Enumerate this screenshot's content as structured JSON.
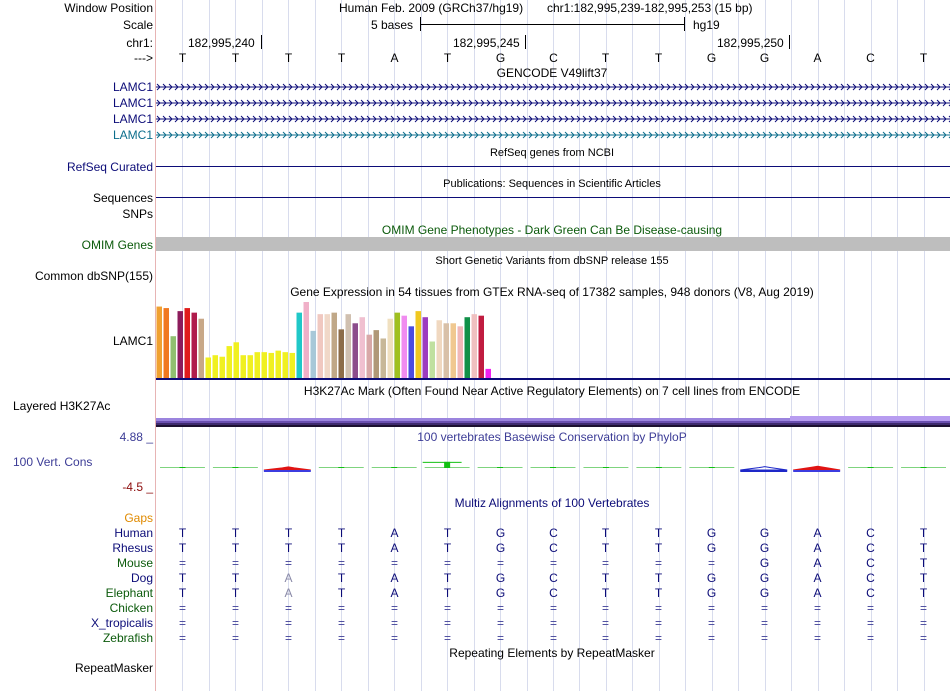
{
  "colors": {
    "gencode_blue": "#0c0c78",
    "gencode_teal": "#0c6e8c",
    "omim_green": "#0b5a0b",
    "conservation_blue": "#3c3c96",
    "conservation_low": "#8c0c0c",
    "gaps_orange": "#e08a00",
    "multiz_blue": "#0c0c78",
    "multiz_green": "#0b5a0b",
    "omim_bar_gray": "#bebebe",
    "h3k27ac_purple": "#6a4fb0"
  },
  "labels": {
    "window_position": "Window Position",
    "scale": "Scale",
    "chr": "chr1:",
    "direction": "--->",
    "gencode_tracks": [
      "LAMC1",
      "LAMC1",
      "LAMC1",
      "LAMC1"
    ],
    "refseq": "RefSeq Curated",
    "sequences": "Sequences",
    "snps": "SNPs",
    "omim": "OMIM Genes",
    "dbsnp": "Common dbSNP(155)",
    "gtex_gene": "LAMC1",
    "h3k27ac": "Layered H3K27Ac",
    "cons_top": "4.88 _",
    "cons_name": "100 Vert. Cons",
    "cons_bottom": "-4.5 _",
    "gaps": "Gaps",
    "species": [
      "Human",
      "Rhesus",
      "Mouse",
      "Dog",
      "Elephant",
      "Chicken",
      "X_tropicalis",
      "Zebrafish"
    ],
    "repeatmasker": "RepeatMasker"
  },
  "header": {
    "assembly": "Human Feb. 2009 (GRCh37/hg19)",
    "position": "chr1:182,995,239-182,995,253 (15 bp)",
    "scale_text": "5 bases",
    "scale_db": "hg19",
    "coords": [
      "182,995,240",
      "182,995,245",
      "182,995,250"
    ]
  },
  "bases": [
    "T",
    "T",
    "T",
    "T",
    "A",
    "T",
    "G",
    "C",
    "T",
    "T",
    "G",
    "G",
    "A",
    "C",
    "T"
  ],
  "track_titles": {
    "gencode": "GENCODE V49lift37",
    "refseq": "RefSeq genes from NCBI",
    "publications": "Publications: Sequences in Scientific Articles",
    "omim": "OMIM Gene Phenotypes - Dark Green Can Be Disease-causing",
    "dbsnp": "Short Genetic Variants from dbSNP release 155",
    "gtex": "Gene Expression in 54 tissues from GTEx RNA-seq of 17382 samples, 948 donors (V8, Aug 2019)",
    "h3k27ac": "H3K27Ac Mark (Often Found Near Active Regulatory Elements) on 7 cell lines from ENCODE",
    "phylop": "100 vertebrates Basewise Conservation by PhyloP",
    "multiz": "Multiz Alignments of 100 Vertebrates",
    "repeatmasker": "Repeating Elements by RepeatMasker"
  },
  "gtex_bars": {
    "colors": [
      "#f0a030",
      "#f07820",
      "#90c070",
      "#8c1c5c",
      "#e01c1c",
      "#b01c4c",
      "#c8a888",
      "#f0f020",
      "#f0f020",
      "#f0f020",
      "#f0f020",
      "#f0f020",
      "#f0f020",
      "#f0f020",
      "#f0f020",
      "#f0f020",
      "#f0f020",
      "#f0f020",
      "#f0f020",
      "#f0f020",
      "#20c8c8",
      "#f0b0c8",
      "#a8c8d8",
      "#f0c8c0",
      "#f0d8c8",
      "#c0a888",
      "#8c6c48",
      "#d0c0b0",
      "#8c4c8c",
      "#f0c0d0",
      "#d8a8a8",
      "#b09878",
      "#c8b898",
      "#f0e0c0",
      "#a0c020",
      "#f08cf0",
      "#4c4ce0",
      "#f0c820",
      "#9c3cc0",
      "#c0e0a0",
      "#f0d8c0",
      "#d8c0a8",
      "#f0c890",
      "#f0b8b8",
      "#109048",
      "#f0c0c0",
      "#c01c40",
      "#f020f0"
    ],
    "values": [
      0.94,
      0.92,
      0.55,
      0.88,
      0.92,
      0.86,
      0.78,
      0.27,
      0.3,
      0.28,
      0.42,
      0.47,
      0.3,
      0.3,
      0.34,
      0.34,
      0.33,
      0.36,
      0.34,
      0.33,
      0.86,
      1.0,
      0.62,
      0.84,
      0.84,
      0.86,
      0.64,
      0.84,
      0.72,
      0.8,
      0.57,
      0.63,
      0.52,
      0.78,
      0.86,
      0.82,
      0.68,
      0.88,
      0.8,
      0.48,
      0.76,
      0.72,
      0.72,
      0.68,
      0.8,
      0.84,
      0.82,
      0.12
    ]
  },
  "phylop": {
    "values": [
      0.06,
      0.02,
      -0.25,
      0.0,
      0.0,
      0.75,
      0.01,
      0.04,
      0.03,
      0.0,
      0.0,
      -0.3,
      -0.4,
      0.02,
      0.05
    ]
  },
  "alignments": [
    {
      "species": "Human",
      "bases": [
        "T",
        "T",
        "T",
        "T",
        "A",
        "T",
        "G",
        "C",
        "T",
        "T",
        "G",
        "G",
        "A",
        "C",
        "T"
      ]
    },
    {
      "species": "Rhesus",
      "bases": [
        "T",
        "T",
        "T",
        "T",
        "A",
        "T",
        "G",
        "C",
        "T",
        "T",
        "G",
        "G",
        "A",
        "C",
        "T"
      ]
    },
    {
      "species": "Mouse",
      "bases": [
        "=",
        "=",
        "=",
        "=",
        "=",
        "=",
        "=",
        "=",
        "=",
        "=",
        "=",
        "G",
        "A",
        "C",
        "T"
      ]
    },
    {
      "species": "Dog",
      "bases": [
        "T",
        "T",
        "A",
        "T",
        "A",
        "T",
        "G",
        "C",
        "T",
        "T",
        "G",
        "G",
        "A",
        "C",
        "T"
      ]
    },
    {
      "species": "Elephant",
      "bases": [
        "T",
        "T",
        "A",
        "T",
        "A",
        "T",
        "G",
        "C",
        "T",
        "T",
        "G",
        "G",
        "A",
        "C",
        "T"
      ]
    },
    {
      "species": "Chicken",
      "bases": [
        "=",
        "=",
        "=",
        "=",
        "=",
        "=",
        "=",
        "=",
        "=",
        "=",
        "=",
        "=",
        "=",
        "=",
        "="
      ]
    },
    {
      "species": "X_tropicalis",
      "bases": [
        "=",
        "=",
        "=",
        "=",
        "=",
        "=",
        "=",
        "=",
        "=",
        "=",
        "=",
        "=",
        "=",
        "=",
        "="
      ]
    },
    {
      "species": "Zebrafish",
      "bases": [
        "=",
        "=",
        "=",
        "=",
        "=",
        "=",
        "=",
        "=",
        "=",
        "=",
        "=",
        "=",
        "=",
        "=",
        "="
      ]
    }
  ]
}
